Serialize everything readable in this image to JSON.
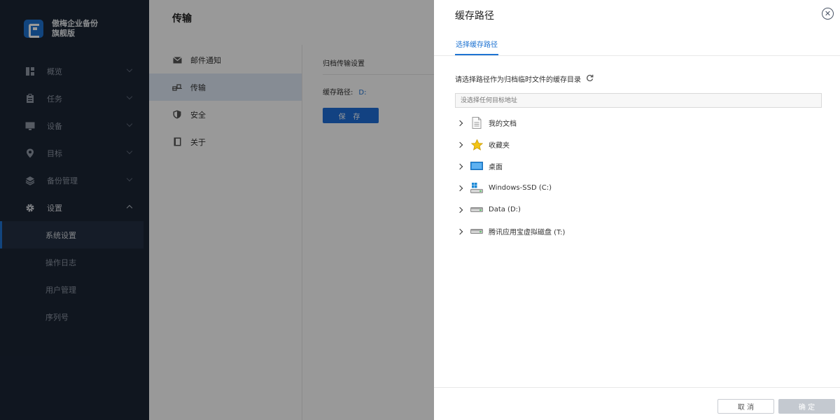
{
  "brand": {
    "name_line1": "傲梅企业备份",
    "name_line2": "旗舰版"
  },
  "sidebar": {
    "items": [
      {
        "label": "概览",
        "icon": "dashboard-icon"
      },
      {
        "label": "任务",
        "icon": "clipboard-icon"
      },
      {
        "label": "设备",
        "icon": "monitor-icon"
      },
      {
        "label": "目标",
        "icon": "location-pin-icon"
      },
      {
        "label": "备份管理",
        "icon": "layers-icon"
      },
      {
        "label": "设置",
        "icon": "gear-icon"
      }
    ],
    "sub_items": [
      "系统设置",
      "操作日志",
      "用户管理",
      "序列号"
    ]
  },
  "header": {
    "title": "传输"
  },
  "settings_menu": {
    "items": [
      {
        "label": "邮件通知",
        "icon": "mail-icon"
      },
      {
        "label": "传输",
        "icon": "transfer-icon"
      },
      {
        "label": "安全",
        "icon": "shield-icon"
      },
      {
        "label": "关于",
        "icon": "info-book-icon"
      }
    ]
  },
  "content": {
    "section_title": "归档传输设置",
    "path_label": "缓存路径:",
    "path_value": "D:",
    "save_label": "保 存"
  },
  "drawer": {
    "title": "缓存路径",
    "close_glyph": "✕",
    "tab_label": "选择缓存路径",
    "instruction": "请选择路径作为归档临时文件的缓存目录",
    "input_placeholder": "没选择任何目标地址",
    "tree": [
      {
        "label": "我的文档",
        "icon": "document-icon"
      },
      {
        "label": "收藏夹",
        "icon": "star-icon"
      },
      {
        "label": "桌面",
        "icon": "desktop-icon"
      },
      {
        "label": "Windows-SSD (C:)",
        "icon": "windows-drive-icon"
      },
      {
        "label": "Data (D:)",
        "icon": "drive-icon"
      },
      {
        "label": "腾讯应用宝虚拟磁盘 (T:)",
        "icon": "drive-icon"
      }
    ],
    "cancel_label": "取 消",
    "ok_label": "确 定"
  },
  "colors": {
    "accent": "#1e73d2",
    "sidebar_bg": "#1b2535",
    "disabled": "#c4c9d0"
  }
}
